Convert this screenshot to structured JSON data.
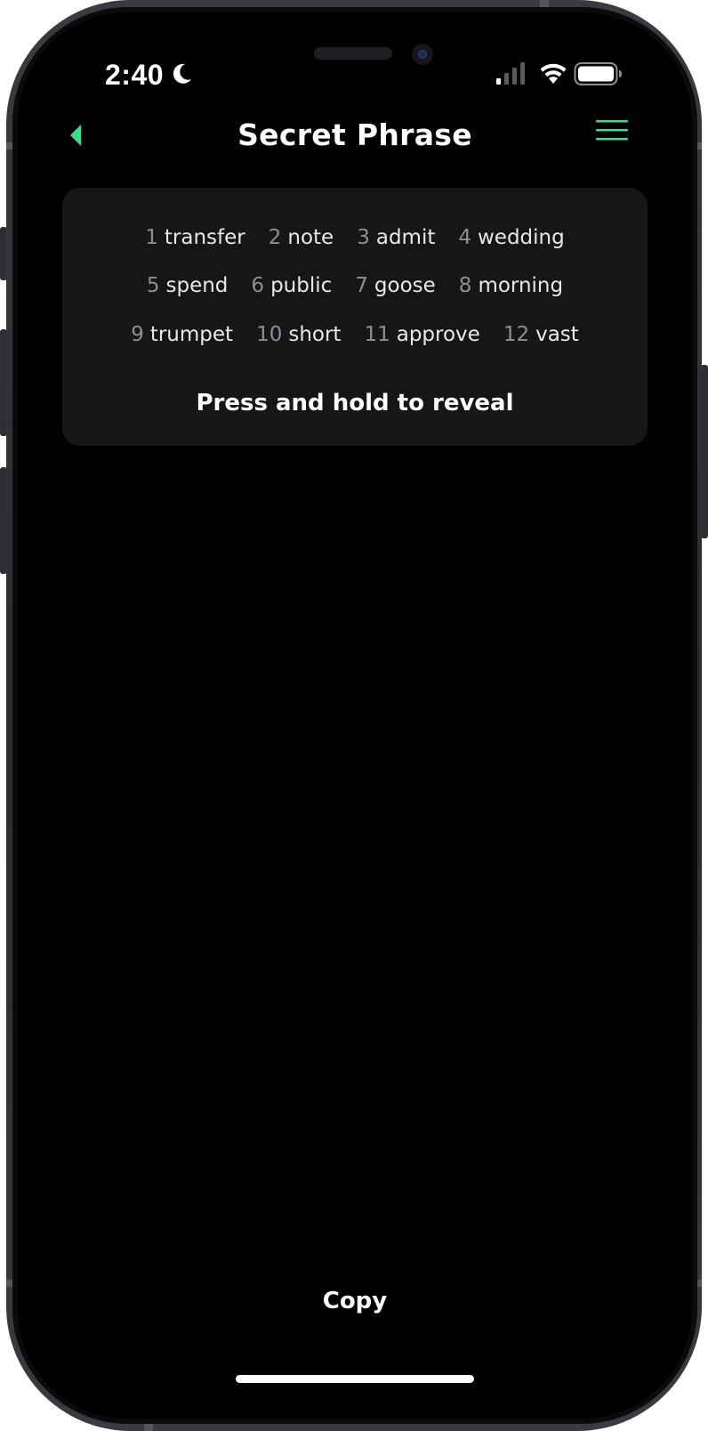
{
  "status_bar": {
    "time": "2:40"
  },
  "header": {
    "title": "Secret Phrase"
  },
  "phrase": {
    "rows": [
      [
        {
          "num": "1",
          "word": "transfer"
        },
        {
          "num": "2",
          "word": "note"
        },
        {
          "num": "3",
          "word": "admit"
        },
        {
          "num": "4",
          "word": "wedding"
        }
      ],
      [
        {
          "num": "5",
          "word": "spend"
        },
        {
          "num": "6",
          "word": "public"
        },
        {
          "num": "7",
          "word": "goose"
        },
        {
          "num": "8",
          "word": "morning"
        }
      ],
      [
        {
          "num": "9",
          "word": "trumpet"
        },
        {
          "num": "10",
          "word": "short"
        },
        {
          "num": "11",
          "word": "approve"
        },
        {
          "num": "12",
          "word": "vast"
        }
      ]
    ],
    "reveal_hint": "Press and hold to reveal"
  },
  "footer": {
    "copy_label": "Copy"
  },
  "icons": {
    "back": "chevron-left-icon",
    "menu": "hamburger-menu-icon",
    "moon": "moon-icon",
    "signal": "cellular-signal-icon",
    "wifi": "wifi-icon",
    "battery": "battery-icon"
  },
  "colors": {
    "accent": "#3ddc97",
    "background": "#000000",
    "card": "#161618",
    "word_number": "#8e8e93",
    "text": "#ffffff"
  }
}
